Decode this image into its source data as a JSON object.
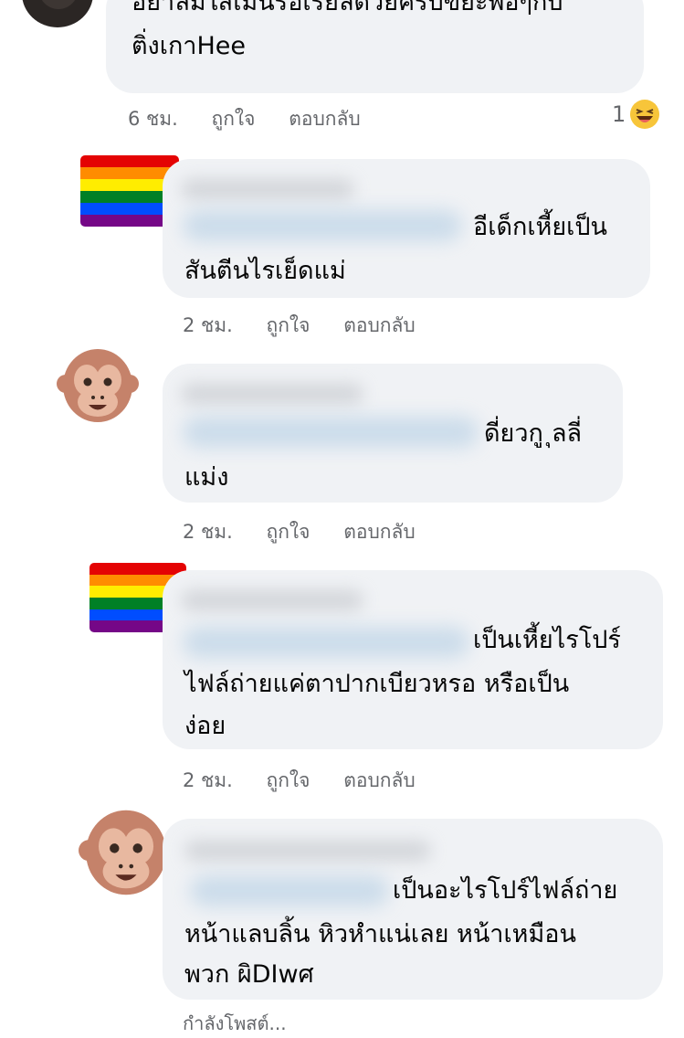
{
  "comments": [
    {
      "lines": [
        "อย่าลืมใส่เมนรอเรียลด้วยครับขยะพอๆกับ",
        "ติ่งเกาHee"
      ],
      "time": "6 ชม.",
      "like": "ถูกใจ",
      "reply": "ตอบกลับ",
      "reaction_count": "1",
      "reaction_icon": "laughing-emoji-icon"
    },
    {
      "avatar": "rainbow-flag-avatar",
      "lines": [
        "อีเด็กเหี้ยเป็น",
        "สันตีนไรเย็ดแม่"
      ],
      "time": "2 ชม.",
      "like": "ถูกใจ",
      "reply": "ตอบกลับ"
    },
    {
      "avatar": "monkey-face-avatar",
      "lines": [
        "ดี่ยวกู ุลลี่",
        "แม่ง"
      ],
      "time": "2 ชม.",
      "like": "ถูกใจ",
      "reply": "ตอบกลับ"
    },
    {
      "avatar": "rainbow-flag-avatar",
      "lines": [
        "เป็นเหี้ยไรโปร์",
        "ไฟล์ถ่ายแค่ตาปากเบียวหรอ   หรือเป็น",
        "ง่อย"
      ],
      "time": "2 ชม.",
      "like": "ถูกใจ",
      "reply": "ตอบกลับ"
    },
    {
      "avatar": "monkey-face-avatar",
      "lines": [
        "เป็นอะไรโปร์ไฟล์ถ่าย",
        "หน้าแลบลิ้น หิวหำแน่เลย หน้าเหมือน",
        "พวก ผิDIwศ"
      ],
      "status": "กำลังโพสต์..."
    }
  ],
  "colors": {
    "bubble": "#f0f2f5",
    "meta_text": "#65676b",
    "rainbow": [
      "#e40303",
      "#ff8c00",
      "#ffed00",
      "#008026",
      "#004dff",
      "#750787"
    ],
    "monkey_fur": "#c5826a",
    "monkey_face": "#e8b8a0"
  }
}
